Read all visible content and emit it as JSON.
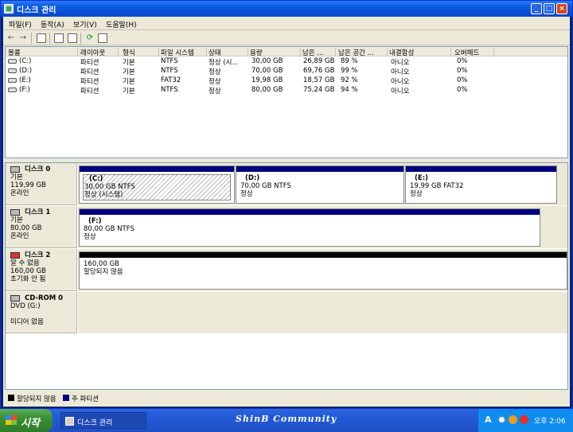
{
  "window": {
    "title": "디스크 관리"
  },
  "menu": [
    "파일(F)",
    "동작(A)",
    "보기(V)",
    "도움말(H)"
  ],
  "volume_table": {
    "columns": [
      "볼륨",
      "레이아웃",
      "형식",
      "파일 시스템",
      "상태",
      "용량",
      "남은 ...",
      "남은 공간 ...",
      "내결함성",
      "오버헤드"
    ],
    "rows": [
      [
        "(C:)",
        "파티션",
        "기본",
        "NTFS",
        "정상 (시...",
        "30,00 GB",
        "26,89 GB",
        "89 %",
        "아니오",
        "0%"
      ],
      [
        "(D:)",
        "파티션",
        "기본",
        "NTFS",
        "정상",
        "70,00 GB",
        "69,76 GB",
        "99 %",
        "아니오",
        "0%"
      ],
      [
        "(E:)",
        "파티션",
        "기본",
        "FAT32",
        "정상",
        "19,98 GB",
        "18,57 GB",
        "92 %",
        "아니오",
        "0%"
      ],
      [
        "(F:)",
        "파티션",
        "기본",
        "NTFS",
        "정상",
        "80,00 GB",
        "75,24 GB",
        "94 %",
        "아니오",
        "0%"
      ]
    ]
  },
  "disks": [
    {
      "name": "디스크 0",
      "type": "기본",
      "size": "119,99 GB",
      "status": "온라인",
      "icon": "disk-icon",
      "partitions": [
        {
          "label": "(C:)",
          "size_fs": "30,00 GB NTFS",
          "status": "정상 (시스템)",
          "selected": true
        },
        {
          "label": "(D:)",
          "size_fs": "70,00 GB NTFS",
          "status": "정상"
        },
        {
          "label": "(E:)",
          "size_fs": "19,99 GB FAT32",
          "status": "정상"
        }
      ]
    },
    {
      "name": "디스크 1",
      "type": "기본",
      "size": "80,00 GB",
      "status": "온라인",
      "icon": "disk-icon",
      "partitions": [
        {
          "label": "(F:)",
          "size_fs": "80,00 GB NTFS",
          "status": "정상"
        }
      ]
    },
    {
      "name": "디스크 2",
      "type": "알 수 없음",
      "size": "160,00 GB",
      "status": "초기화 안 됨",
      "icon": "disk-error-icon",
      "partitions": [
        {
          "label": "",
          "size_fs": "160,00 GB",
          "status": "할당되지 않음"
        }
      ]
    },
    {
      "name": "CD-ROM 0",
      "type": "DVD (G:)",
      "size": "",
      "status": "미디어 없음",
      "icon": "cdrom-icon",
      "partitions": []
    }
  ],
  "legend": [
    {
      "label": "할당되지 않음",
      "color": "#000000"
    },
    {
      "label": "주 파티션",
      "color": "#00007f"
    }
  ],
  "taskbar": {
    "start_label": "시작",
    "task_label": "디스크 관리",
    "banner": "ShinB  Community",
    "tray_lang": "A",
    "clock": "오후 2:06"
  },
  "colors": {
    "primary_partition": "#00007f",
    "unallocated": "#000000",
    "titlebar": "#0a58e0"
  }
}
